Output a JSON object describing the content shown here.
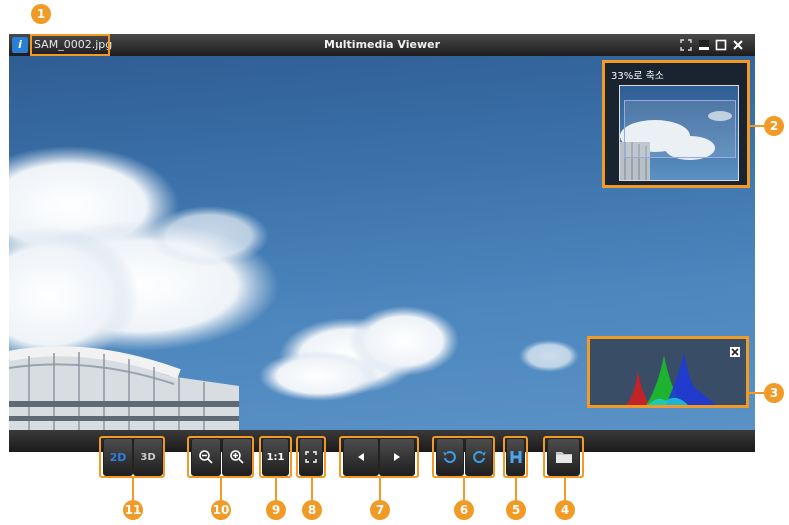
{
  "window": {
    "file_name": "SAM_0002.jpg",
    "title": "Multimedia Viewer",
    "app_icon_glyph": "i"
  },
  "navigator": {
    "zoom_label": "33%로 축소"
  },
  "toolbar": {
    "mode_2d_label": "2D",
    "mode_3d_label": "3D",
    "actual_size_label": "1:1"
  },
  "annotations": [
    "1",
    "2",
    "3",
    "4",
    "5",
    "6",
    "7",
    "8",
    "9",
    "10",
    "11"
  ],
  "colors": {
    "callout": "#f19a25",
    "titlebar": "#2a2a2a",
    "mode_2d_accent": "#2e7de0"
  }
}
